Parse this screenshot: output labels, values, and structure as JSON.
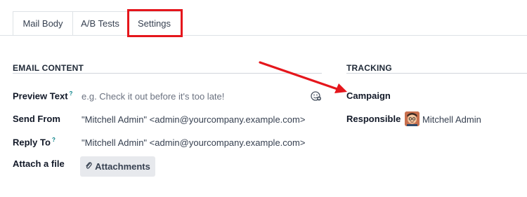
{
  "tabs": [
    {
      "label": "Mail Body"
    },
    {
      "label": "A/B Tests"
    },
    {
      "label": "Settings"
    }
  ],
  "email_content": {
    "title": "EMAIL CONTENT",
    "preview_text": {
      "label": "Preview Text",
      "tip": "?",
      "placeholder": "e.g. Check it out before it's too late!"
    },
    "send_from": {
      "label": "Send From",
      "value": "\"Mitchell Admin\" <admin@yourcompany.example.com>"
    },
    "reply_to": {
      "label": "Reply To",
      "tip": "?",
      "value": "\"Mitchell Admin\" <admin@yourcompany.example.com>"
    },
    "attach": {
      "label": "Attach a file",
      "button": "Attachments"
    }
  },
  "tracking": {
    "title": "TRACKING",
    "campaign": {
      "label": "Campaign"
    },
    "responsible": {
      "label": "Responsible",
      "value": "Mitchell Admin"
    }
  },
  "annotations": {
    "highlight_color": "#e5161c",
    "arrow_color": "#e5161c"
  },
  "icons": [
    "emoji-icon",
    "paperclip-icon",
    "avatar"
  ]
}
